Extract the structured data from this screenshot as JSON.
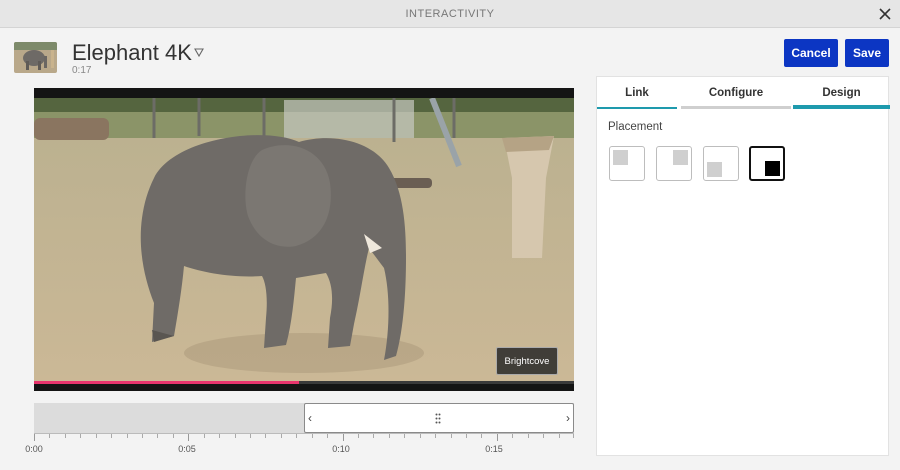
{
  "window": {
    "title": "INTERACTIVITY",
    "close_icon": "close-icon"
  },
  "video": {
    "title": "Elephant 4K",
    "duration": "0:17",
    "thumbnail_icon": "video-thumbnail",
    "title_menu_icon": "caret-down-icon"
  },
  "actions": {
    "cancel_label": "Cancel",
    "save_label": "Save"
  },
  "player": {
    "watermark_label": "Brightcove",
    "progress": 0.49
  },
  "timeline": {
    "range_start": "0:08.6",
    "range_end": "0:17",
    "tick_labels": [
      "0:00",
      "0:05",
      "0:10",
      "0:15"
    ],
    "left_arrow": "‹",
    "right_arrow": "›"
  },
  "panel": {
    "tabs": [
      {
        "label": "Link"
      },
      {
        "label": "Configure"
      },
      {
        "label": "Design"
      }
    ],
    "active_tab": "Design",
    "placement_label": "Placement",
    "placement_options": [
      "top-left",
      "top-right",
      "bottom-left",
      "bottom-right"
    ],
    "selected_placement": "bottom-right"
  },
  "colors": {
    "primary_button": "#0c36c3",
    "tab_accent": "#1e9aad",
    "progress": "#e8346d"
  }
}
